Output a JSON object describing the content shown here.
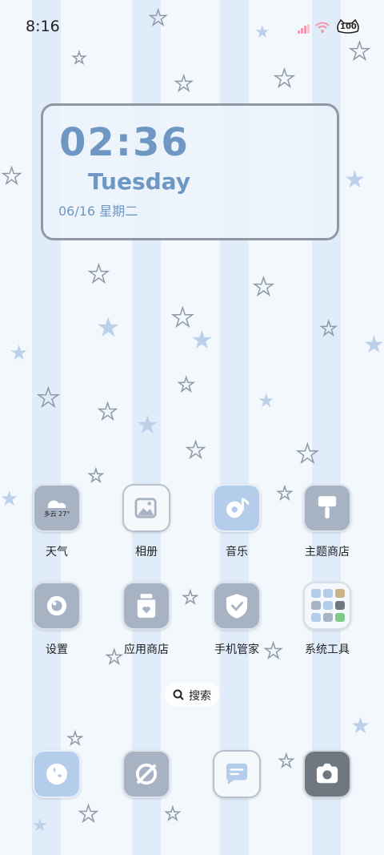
{
  "status_bar": {
    "time": "8:16",
    "battery": "100"
  },
  "clock_widget": {
    "time": "02:36",
    "weekday": "Tuesday",
    "date": "06/16 星期二"
  },
  "apps_row1": [
    {
      "label": "天气",
      "badge": "多云 27°",
      "icon": "weather-icon"
    },
    {
      "label": "相册",
      "icon": "gallery-icon"
    },
    {
      "label": "音乐",
      "icon": "music-icon"
    },
    {
      "label": "主题商店",
      "icon": "theme-brush-icon"
    }
  ],
  "apps_row2": [
    {
      "label": "设置",
      "icon": "settings-icon"
    },
    {
      "label": "应用商店",
      "icon": "app-store-icon"
    },
    {
      "label": "手机管家",
      "icon": "shield-icon"
    },
    {
      "label": "系统工具",
      "icon": "folder-icon"
    }
  ],
  "search": {
    "label": "搜索"
  },
  "dock": [
    {
      "name": "phone",
      "icon": "phone-icon"
    },
    {
      "name": "browser",
      "icon": "browser-icon"
    },
    {
      "name": "messages",
      "icon": "message-icon"
    },
    {
      "name": "camera",
      "icon": "camera-icon"
    }
  ],
  "colors": {
    "accent": "#6e97c3",
    "tile_gray": "#a7b2c3",
    "tile_blue": "#b4cdea",
    "tile_dark": "#6f7781",
    "signal": "#f09ab0"
  }
}
